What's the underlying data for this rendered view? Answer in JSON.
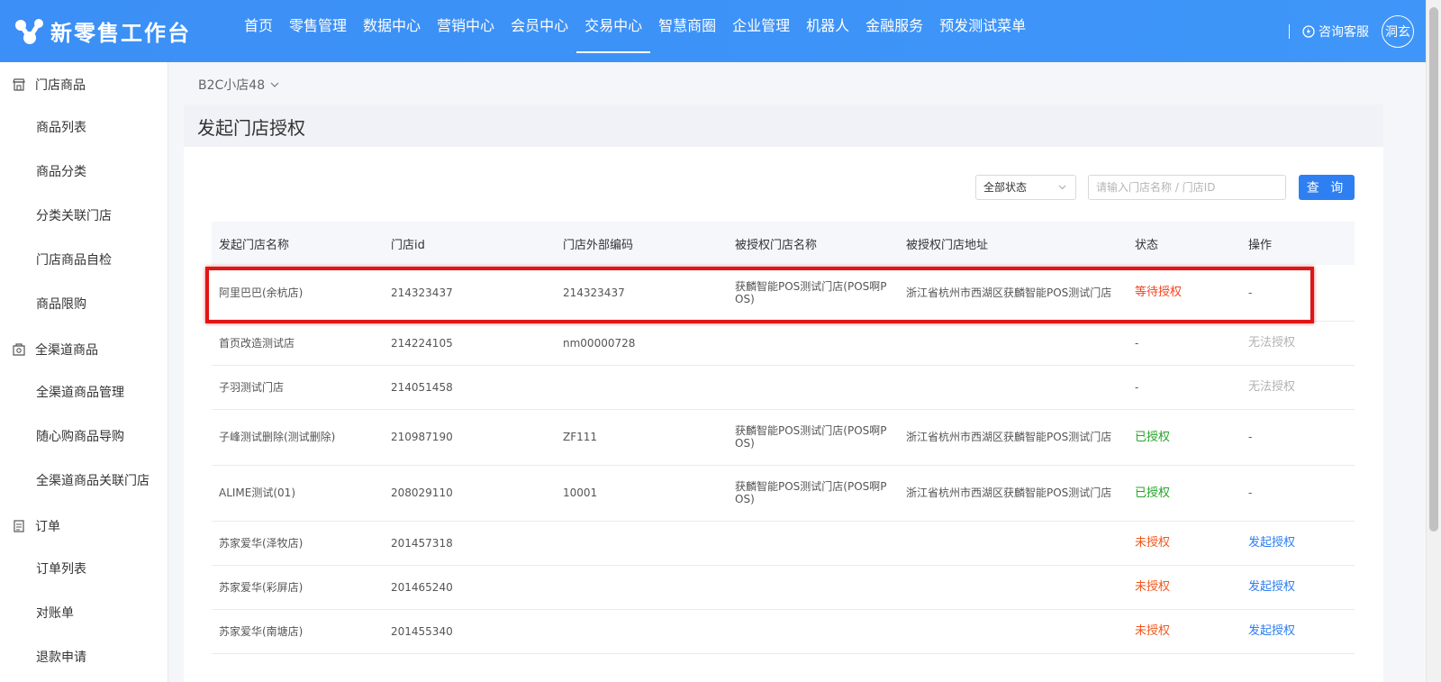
{
  "header": {
    "logo_text": "新零售工作台",
    "nav": [
      "首页",
      "零售管理",
      "数据中心",
      "营销中心",
      "会员中心",
      "交易中心",
      "智慧商圈",
      "企业管理",
      "机器人",
      "金融服务",
      "预发测试菜单"
    ],
    "active_nav": "交易中心",
    "service_label": "咨询客服",
    "avatar_label": "洞玄"
  },
  "sidebar": {
    "groups": [
      {
        "label": "门店商品",
        "icon": "store-icon",
        "items": [
          "商品列表",
          "商品分类",
          "分类关联门店",
          "门店商品自检",
          "商品限购"
        ]
      },
      {
        "label": "全渠道商品",
        "icon": "omni-channel-icon",
        "items": [
          "全渠道商品管理",
          "随心购商品导购",
          "全渠道商品关联门店"
        ]
      },
      {
        "label": "订单",
        "icon": "order-icon",
        "items": [
          "订单列表",
          "对账单",
          "退款申请"
        ]
      }
    ]
  },
  "breadcrumb": {
    "store": "B2C小店48"
  },
  "page_title": "发起门店授权",
  "filters": {
    "status_value": "全部状态",
    "search_placeholder": "请输入门店名称 / 门店ID",
    "query_label": "查 询"
  },
  "table": {
    "columns": [
      "发起门店名称",
      "门店id",
      "门店外部编码",
      "被授权门店名称",
      "被授权门店地址",
      "状态",
      "操作"
    ],
    "rows": [
      {
        "name": "阿里巴巴(余杭店)",
        "id": "214323437",
        "code": "214323437",
        "auth_name": "获麟智能POS测试门店(POS啊POS)",
        "auth_addr": "浙江省杭州市西湖区获麟智能POS测试门店",
        "status": "等待授权",
        "status_type": "wait",
        "op": "-",
        "op_type": "none"
      },
      {
        "name": "首页改造测试店",
        "id": "214224105",
        "code": "nm00000728",
        "auth_name": "",
        "auth_addr": "",
        "status": "-",
        "status_type": "none",
        "op": "无法授权",
        "op_type": "disabled"
      },
      {
        "name": "子羽测试门店",
        "id": "214051458",
        "code": "",
        "auth_name": "",
        "auth_addr": "",
        "status": "-",
        "status_type": "none",
        "op": "无法授权",
        "op_type": "disabled"
      },
      {
        "name": "子峰测试删除(测试删除)",
        "id": "210987190",
        "code": "ZF111",
        "auth_name": "获麟智能POS测试门店(POS啊POS)",
        "auth_addr": "浙江省杭州市西湖区获麟智能POS测试门店",
        "status": "已授权",
        "status_type": "ok",
        "op": "-",
        "op_type": "none"
      },
      {
        "name": "ALIME测试(01)",
        "id": "208029110",
        "code": "10001",
        "auth_name": "获麟智能POS测试门店(POS啊POS)",
        "auth_addr": "浙江省杭州市西湖区获麟智能POS测试门店",
        "status": "已授权",
        "status_type": "ok",
        "op": "-",
        "op_type": "none"
      },
      {
        "name": "苏家爱华(泽牧店)",
        "id": "201457318",
        "code": "",
        "auth_name": "",
        "auth_addr": "",
        "status": "未授权",
        "status_type": "no",
        "op": "发起授权",
        "op_type": "link"
      },
      {
        "name": "苏家爱华(彩屏店)",
        "id": "201465240",
        "code": "",
        "auth_name": "",
        "auth_addr": "",
        "status": "未授权",
        "status_type": "no",
        "op": "发起授权",
        "op_type": "link"
      },
      {
        "name": "苏家爱华(南塘店)",
        "id": "201455340",
        "code": "",
        "auth_name": "",
        "auth_addr": "",
        "status": "未授权",
        "status_type": "no",
        "op": "发起授权",
        "op_type": "link"
      }
    ]
  },
  "colors": {
    "brand": "#3a8ef6",
    "link": "#2d7ef0",
    "highlight": "#e01515"
  }
}
